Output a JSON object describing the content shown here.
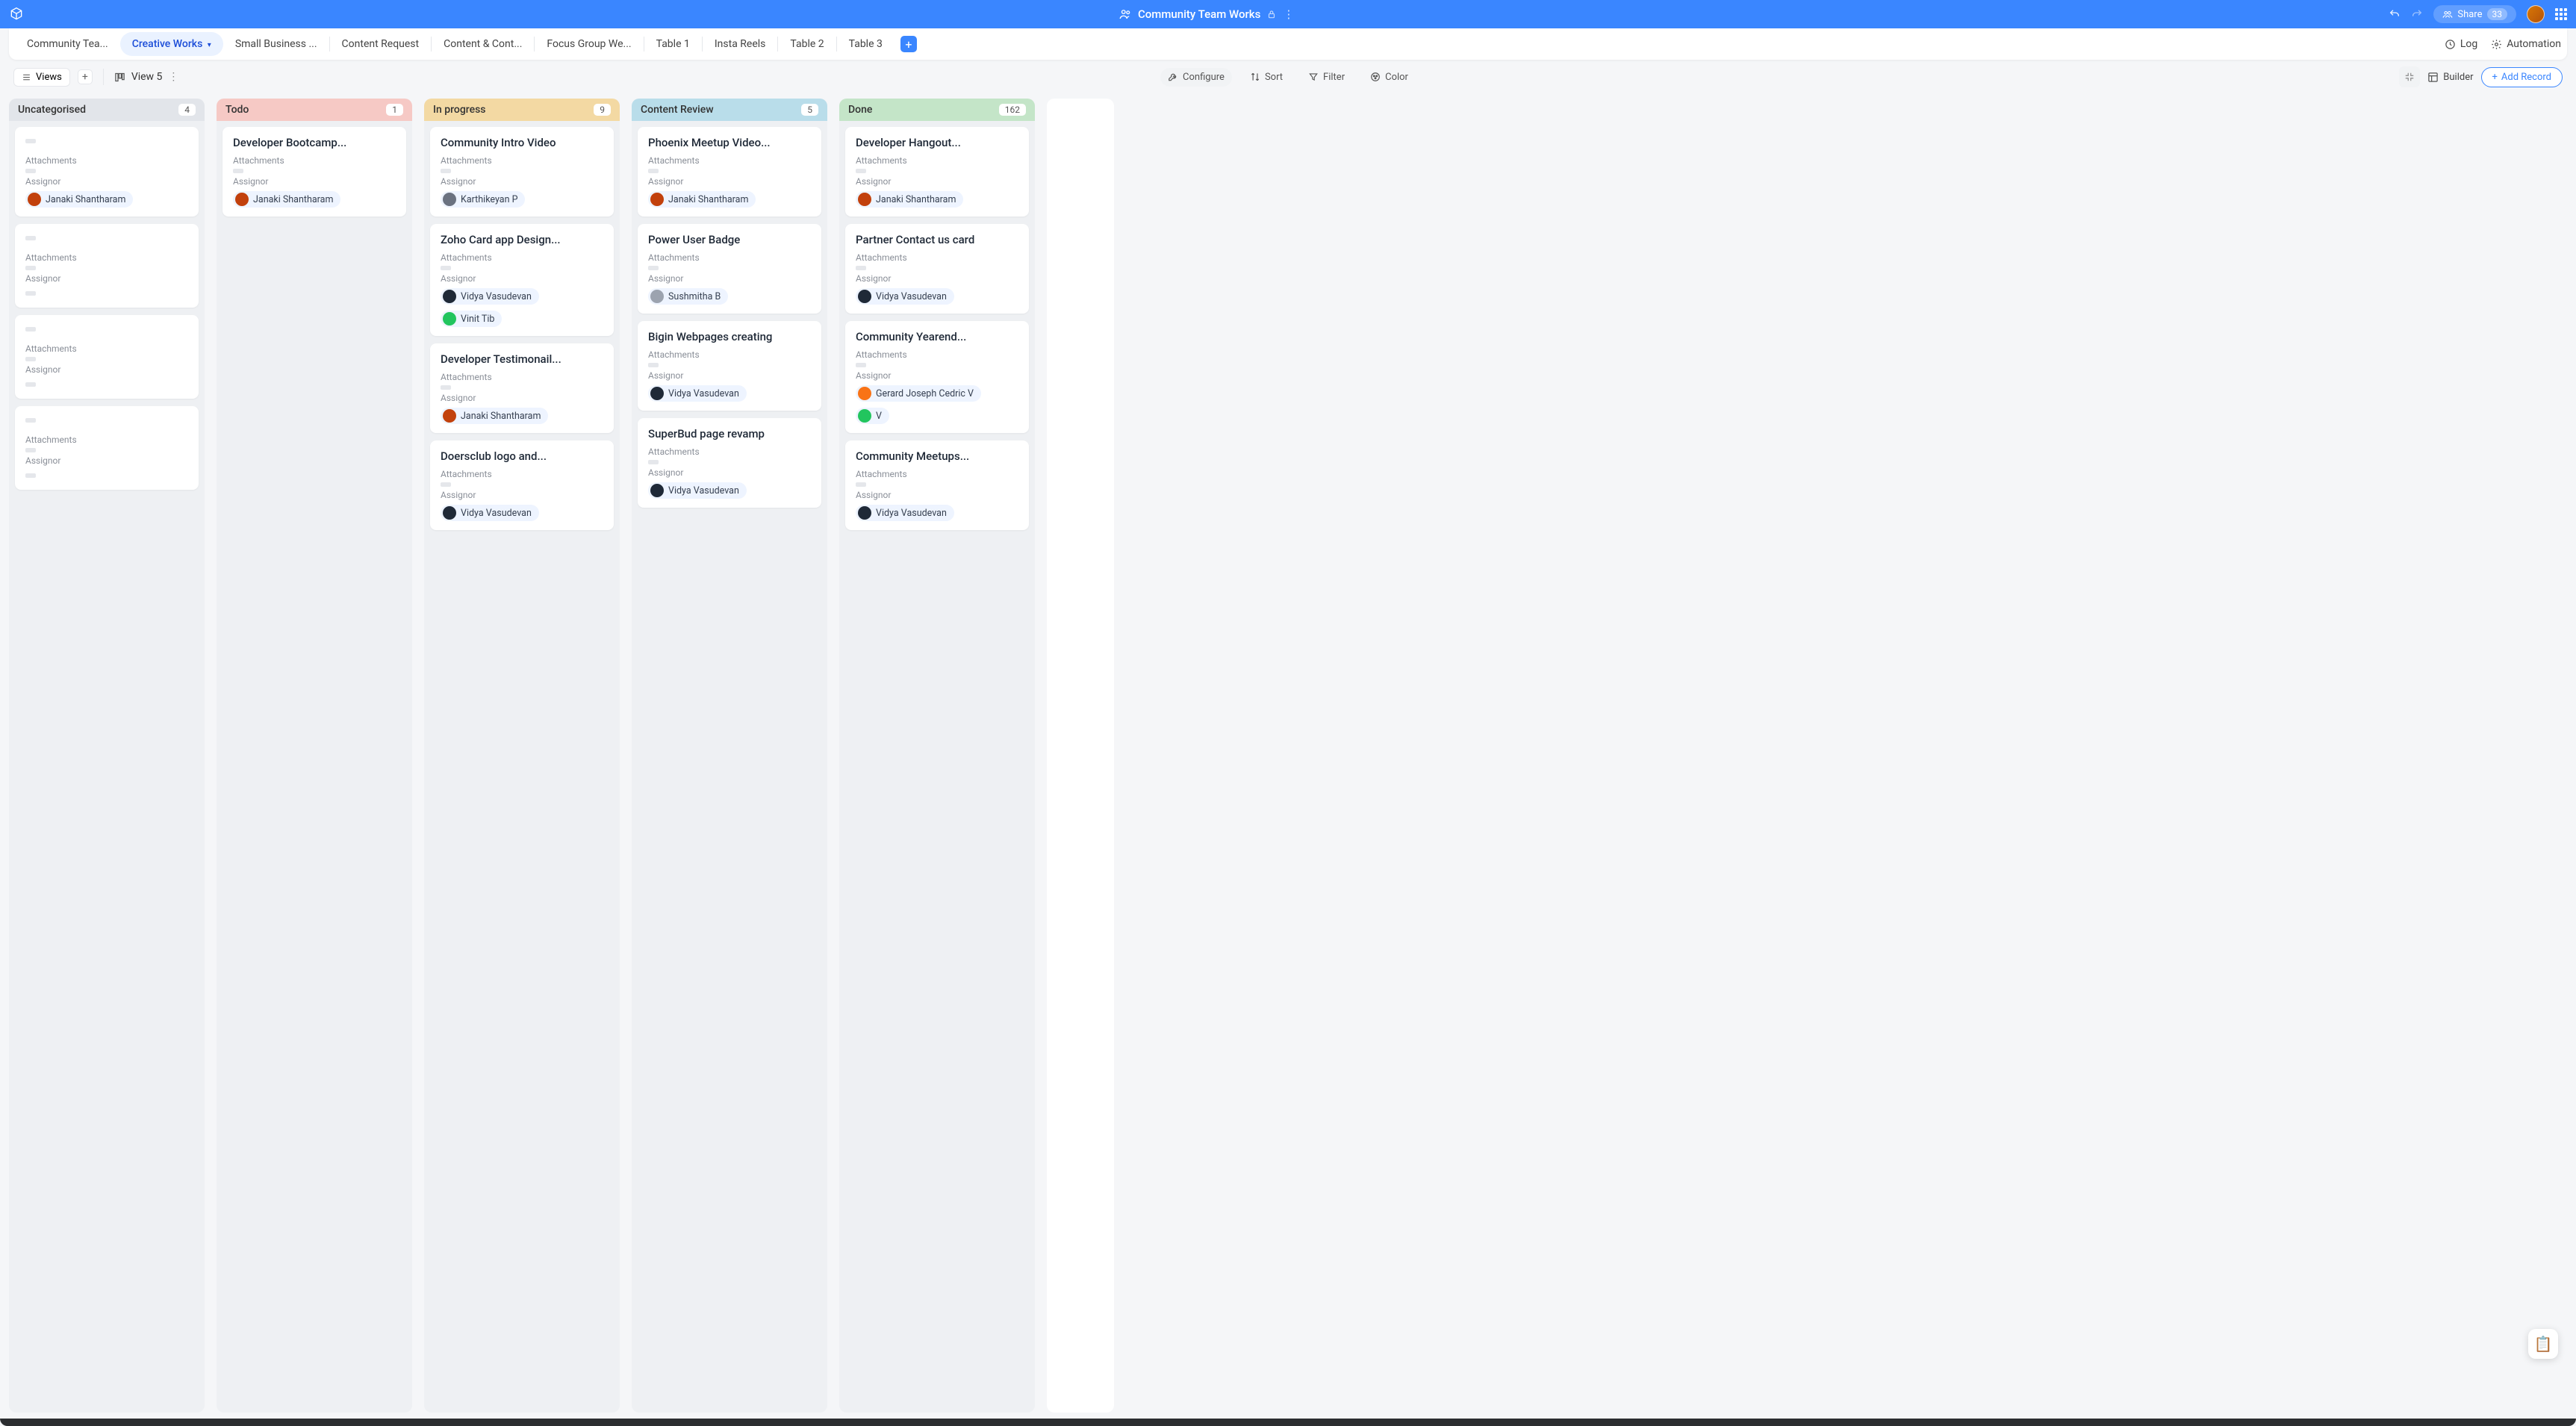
{
  "topbar": {
    "title": "Community Team Works",
    "share_label": "Share",
    "share_count": "33"
  },
  "tabs": [
    "Community Tea...",
    "Creative Works",
    "Small Business ...",
    "Content Request",
    "Content & Cont...",
    "Focus Group We...",
    "Table 1",
    "Insta Reels",
    "Table 2",
    "Table 3"
  ],
  "tabs_active_index": 1,
  "tabs_right": {
    "log": "Log",
    "automation": "Automation"
  },
  "toolbar": {
    "views": "Views",
    "view_name": "View 5",
    "configure": "Configure",
    "sort": "Sort",
    "filter": "Filter",
    "color": "Color",
    "builder": "Builder",
    "add_record": "Add Record"
  },
  "columns": [
    {
      "name": "Uncategorised",
      "count": "4",
      "hdr_class": "hdr-grey",
      "cards": [
        {
          "title": "",
          "assignors": [
            {
              "name": "Janaki Shantharam",
              "color": "#c2410c"
            }
          ]
        },
        {
          "title": "",
          "assignors": []
        },
        {
          "title": "",
          "assignors": []
        },
        {
          "title": "",
          "assignors": []
        }
      ]
    },
    {
      "name": "Todo",
      "count": "1",
      "hdr_class": "hdr-red",
      "cards": [
        {
          "title": "Developer Bootcamp...",
          "assignors": [
            {
              "name": "Janaki Shantharam",
              "color": "#c2410c"
            }
          ]
        }
      ]
    },
    {
      "name": "In progress",
      "count": "9",
      "hdr_class": "hdr-yellow",
      "cards": [
        {
          "title": "Community Intro Video",
          "assignors": [
            {
              "name": "Karthikeyan P",
              "color": "#6b7280"
            }
          ]
        },
        {
          "title": "Zoho Card app Design...",
          "assignors": [
            {
              "name": "Vidya Vasudevan",
              "color": "#1f2937"
            },
            {
              "name": "Vinit Tib",
              "color": "#22c55e"
            }
          ]
        },
        {
          "title": "Developer Testimonail...",
          "assignors": [
            {
              "name": "Janaki Shantharam",
              "color": "#c2410c"
            }
          ]
        },
        {
          "title": "Doersclub logo and...",
          "assignors": [
            {
              "name": "Vidya Vasudevan",
              "color": "#1f2937"
            }
          ]
        }
      ]
    },
    {
      "name": "Content Review",
      "count": "5",
      "hdr_class": "hdr-blue",
      "cards": [
        {
          "title": "Phoenix Meetup Video...",
          "assignors": [
            {
              "name": "Janaki Shantharam",
              "color": "#c2410c"
            }
          ]
        },
        {
          "title": "Power User Badge",
          "assignors": [
            {
              "name": "Sushmitha B",
              "color": "#9ca3af"
            }
          ]
        },
        {
          "title": "Bigin Webpages creating",
          "assignors": [
            {
              "name": "Vidya Vasudevan",
              "color": "#1f2937"
            }
          ]
        },
        {
          "title": "SuperBud page revamp",
          "assignors": [
            {
              "name": "Vidya Vasudevan",
              "color": "#1f2937"
            }
          ]
        }
      ]
    },
    {
      "name": "Done",
      "count": "162",
      "hdr_class": "hdr-green",
      "cards": [
        {
          "title": "Developer Hangout...",
          "assignors": [
            {
              "name": "Janaki Shantharam",
              "color": "#c2410c"
            }
          ]
        },
        {
          "title": "Partner Contact us card",
          "assignors": [
            {
              "name": "Vidya Vasudevan",
              "color": "#1f2937"
            }
          ]
        },
        {
          "title": "Community Yearend...",
          "assignors": [
            {
              "name": "Gerard Joseph Cedric V",
              "color": "#f97316"
            },
            {
              "name": "V",
              "color": "#22c55e"
            }
          ]
        },
        {
          "title": "Community Meetups...",
          "assignors": [
            {
              "name": "Vidya Vasudevan",
              "color": "#1f2937"
            }
          ]
        }
      ]
    }
  ],
  "labels": {
    "attachments": "Attachments",
    "assignor": "Assignor"
  }
}
